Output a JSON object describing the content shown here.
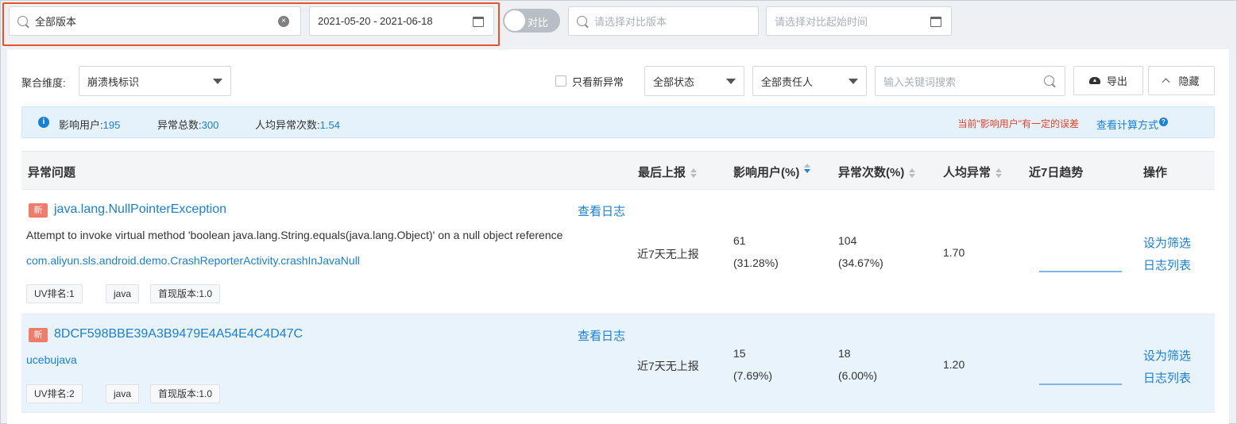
{
  "topbar": {
    "version_value": "全部版本",
    "date_range": "2021-05-20 - 2021-06-18",
    "compare_toggle": "对比",
    "compare_version_placeholder": "请选择对比版本",
    "compare_start_placeholder": "请选择对比起始时间"
  },
  "filters": {
    "aggregate_label": "聚合维度:",
    "aggregate_value": "崩溃栈标识",
    "only_new_label": "只看新异常",
    "status_value": "全部状态",
    "owner_value": "全部责任人",
    "keyword_placeholder": "输入关键词搜索",
    "export_label": "导出",
    "hide_label": "隐藏"
  },
  "summary": {
    "users_label": "影响用户:",
    "users_value": "195",
    "total_label": "异常总数:",
    "total_value": "300",
    "avg_label": "人均异常次数:",
    "avg_value": "1.54",
    "warning": "当前\"影响用户\"有一定的误差",
    "calc_link": "查看计算方式"
  },
  "table": {
    "headers": {
      "issue": "异常问题",
      "last_report": "最后上报",
      "users": "影响用户(%)",
      "count": "异常次数(%)",
      "avg": "人均异常",
      "trend": "近7日趋势",
      "actions": "操作"
    },
    "rows": [
      {
        "badge": "新",
        "title": "java.lang.NullPointerException",
        "view_log": "查看日志",
        "description": "Attempt to invoke virtual method 'boolean java.lang.String.equals(java.lang.Object)' on a null object reference",
        "package": "com.aliyun.sls.android.demo.CrashReporterActivity.crashInJavaNull",
        "tags": [
          "UV排名:1",
          "java",
          "首现版本:1.0"
        ],
        "last_report": "近7天无上报",
        "users": "61",
        "users_pct": "(31.28%)",
        "count": "104",
        "count_pct": "(34.67%)",
        "avg": "1.70",
        "action_filter": "设为筛选",
        "action_log": "日志列表"
      },
      {
        "badge": "新",
        "title": "8DCF598BBE39A3B9479E4A54E4C4D47C",
        "view_log": "查看日志",
        "package": "ucebujava",
        "tags": [
          "UV排名:2",
          "java",
          "首现版本:1.0"
        ],
        "last_report": "近7天无上报",
        "users": "15",
        "users_pct": "(7.69%)",
        "count": "18",
        "count_pct": "(6.00%)",
        "avg": "1.20",
        "action_filter": "设为筛选",
        "action_log": "日志列表"
      }
    ]
  },
  "colors": {
    "accent": "#1a7fd6",
    "highlight_border": "#e8542a",
    "new_badge": "#f27c6c",
    "warning_text": "#e0422c"
  }
}
